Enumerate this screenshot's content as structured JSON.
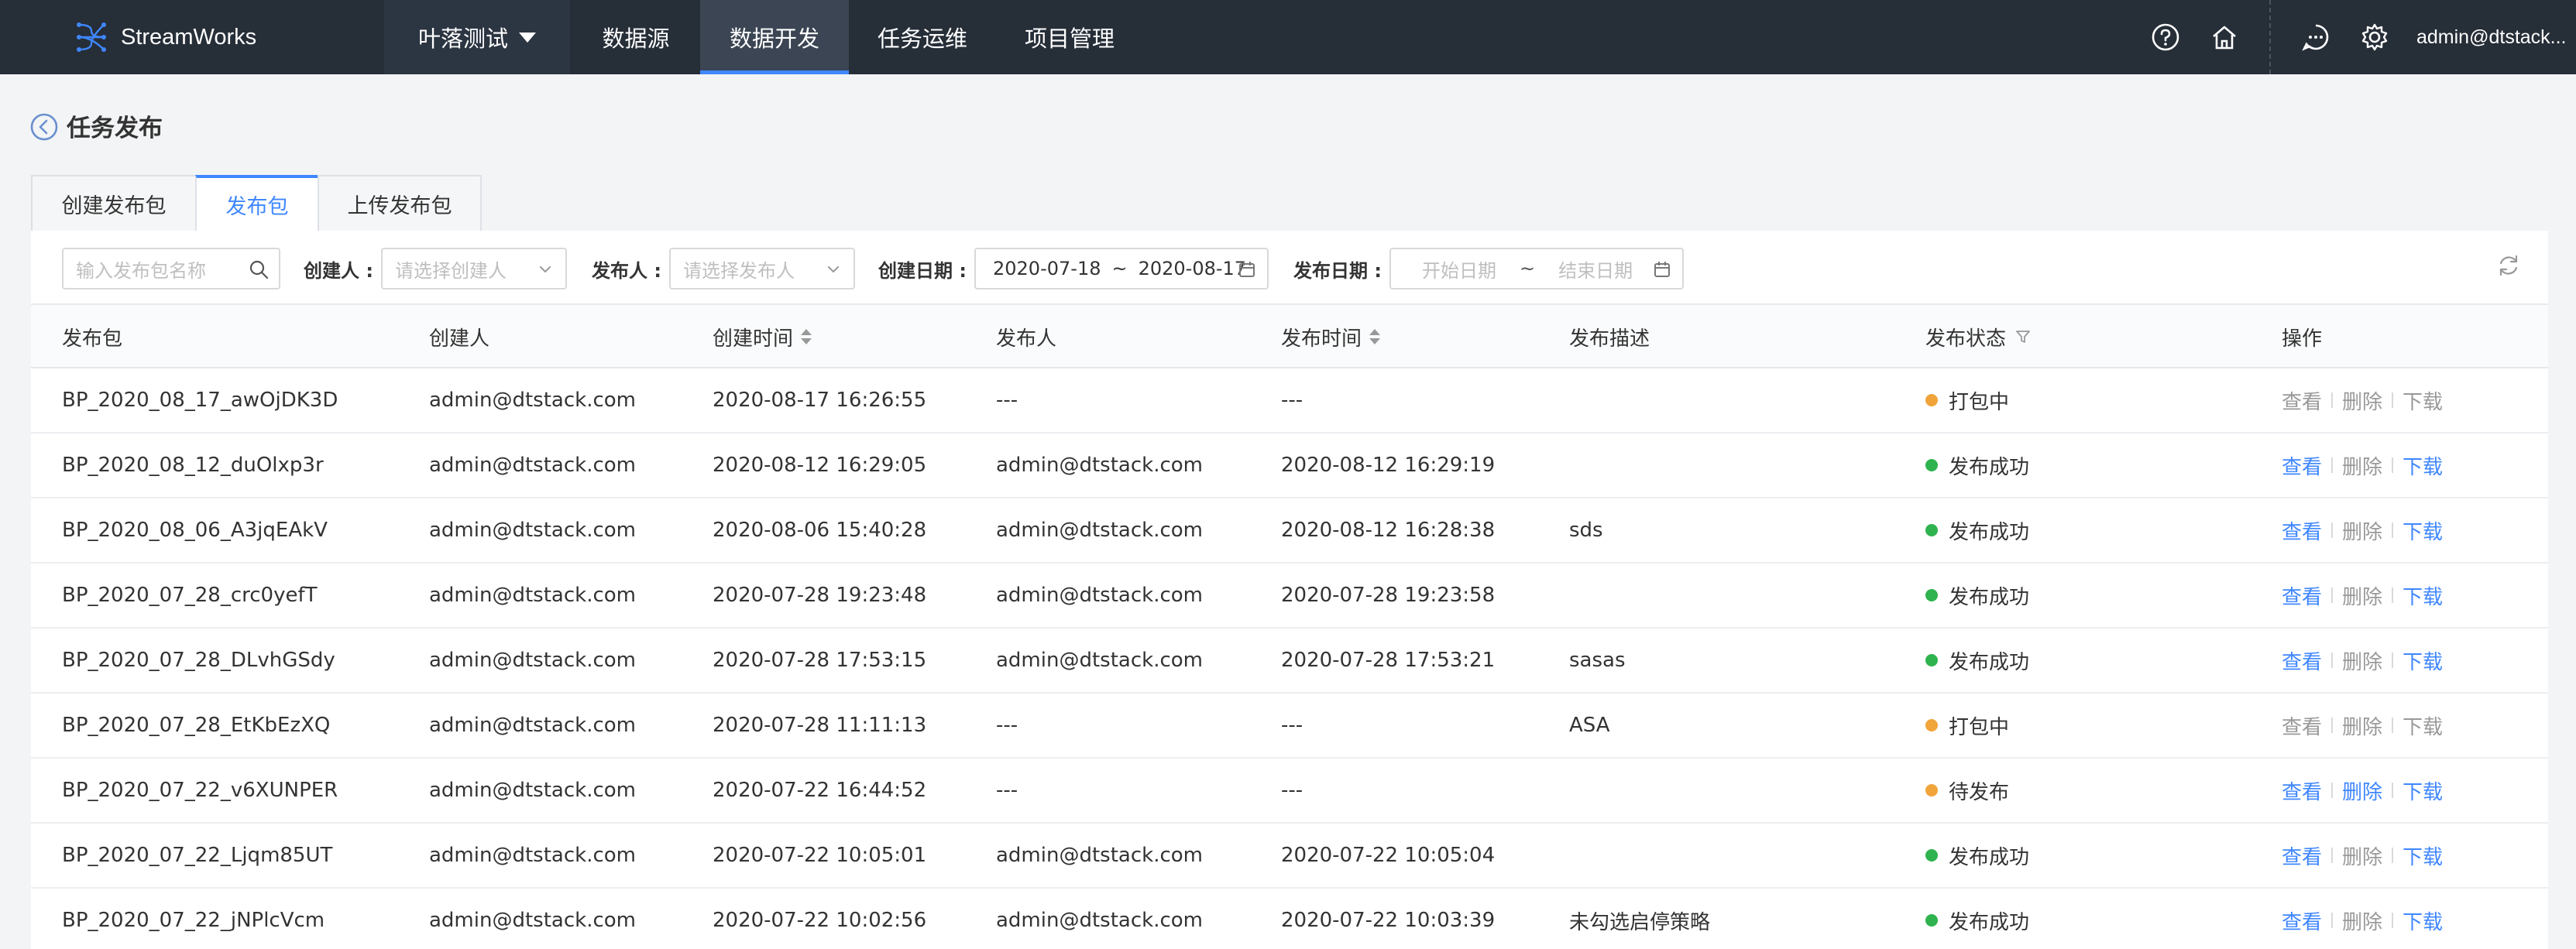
{
  "topbar": {
    "brand": "StreamWorks",
    "project": "叶落测试",
    "nav": [
      "数据源",
      "数据开发",
      "任务运维",
      "项目管理"
    ],
    "active_nav": "数据开发",
    "user": "admin@dtstack..."
  },
  "page": {
    "title": "任务发布"
  },
  "tabs": [
    "创建发布包",
    "发布包",
    "上传发布包"
  ],
  "active_tab": "发布包",
  "filters": {
    "search_placeholder": "输入发布包名称",
    "creator_label": "创建人 :",
    "creator_placeholder": "请选择创建人",
    "publisher_label": "发布人 :",
    "publisher_placeholder": "请选择发布人",
    "create_date_label": "创建日期 :",
    "create_date_start": "2020-07-18",
    "create_date_end": "2020-08-17",
    "range_sep": "~",
    "publish_date_label": "发布日期 :",
    "publish_start_placeholder": "开始日期",
    "publish_end_placeholder": "结束日期"
  },
  "table": {
    "columns": [
      "发布包",
      "创建人",
      "创建时间",
      "发布人",
      "发布时间",
      "发布描述",
      "发布状态",
      "操作"
    ],
    "actions": {
      "view": "查看",
      "delete": "删除",
      "download": "下载"
    },
    "status_colors": {
      "打包中": "#f0a43a",
      "发布成功": "#2fb34f",
      "待发布": "#f0a43a"
    },
    "rows": [
      {
        "name": "BP_2020_08_17_awOjDK3D",
        "creator": "admin@dtstack.com",
        "created": "2020-08-17 16:26:55",
        "publisher": "---",
        "published": "---",
        "desc": "",
        "status": "打包中",
        "view": false,
        "del": false,
        "dl": false
      },
      {
        "name": "BP_2020_08_12_duOlxp3r",
        "creator": "admin@dtstack.com",
        "created": "2020-08-12 16:29:05",
        "publisher": "admin@dtstack.com",
        "published": "2020-08-12 16:29:19",
        "desc": "",
        "status": "发布成功",
        "view": true,
        "del": false,
        "dl": true
      },
      {
        "name": "BP_2020_08_06_A3jqEAkV",
        "creator": "admin@dtstack.com",
        "created": "2020-08-06 15:40:28",
        "publisher": "admin@dtstack.com",
        "published": "2020-08-12 16:28:38",
        "desc": "sds",
        "status": "发布成功",
        "view": true,
        "del": false,
        "dl": true
      },
      {
        "name": "BP_2020_07_28_crc0yefT",
        "creator": "admin@dtstack.com",
        "created": "2020-07-28 19:23:48",
        "publisher": "admin@dtstack.com",
        "published": "2020-07-28 19:23:58",
        "desc": "",
        "status": "发布成功",
        "view": true,
        "del": false,
        "dl": true
      },
      {
        "name": "BP_2020_07_28_DLvhGSdy",
        "creator": "admin@dtstack.com",
        "created": "2020-07-28 17:53:15",
        "publisher": "admin@dtstack.com",
        "published": "2020-07-28 17:53:21",
        "desc": "sasas",
        "status": "发布成功",
        "view": true,
        "del": false,
        "dl": true
      },
      {
        "name": "BP_2020_07_28_EtKbEzXQ",
        "creator": "admin@dtstack.com",
        "created": "2020-07-28 11:11:13",
        "publisher": "---",
        "published": "---",
        "desc": "ASA",
        "status": "打包中",
        "view": false,
        "del": false,
        "dl": false
      },
      {
        "name": "BP_2020_07_22_v6XUNPER",
        "creator": "admin@dtstack.com",
        "created": "2020-07-22 16:44:52",
        "publisher": "---",
        "published": "---",
        "desc": "",
        "status": "待发布",
        "view": true,
        "del": true,
        "dl": true
      },
      {
        "name": "BP_2020_07_22_Ljqm85UT",
        "creator": "admin@dtstack.com",
        "created": "2020-07-22 10:05:01",
        "publisher": "admin@dtstack.com",
        "published": "2020-07-22 10:05:04",
        "desc": "",
        "status": "发布成功",
        "view": true,
        "del": false,
        "dl": true
      },
      {
        "name": "BP_2020_07_22_jNPlcVcm",
        "creator": "admin@dtstack.com",
        "created": "2020-07-22 10:02:56",
        "publisher": "admin@dtstack.com",
        "published": "2020-07-22 10:03:39",
        "desc": "未勾选启停策略",
        "status": "发布成功",
        "view": true,
        "del": false,
        "dl": true
      }
    ]
  }
}
